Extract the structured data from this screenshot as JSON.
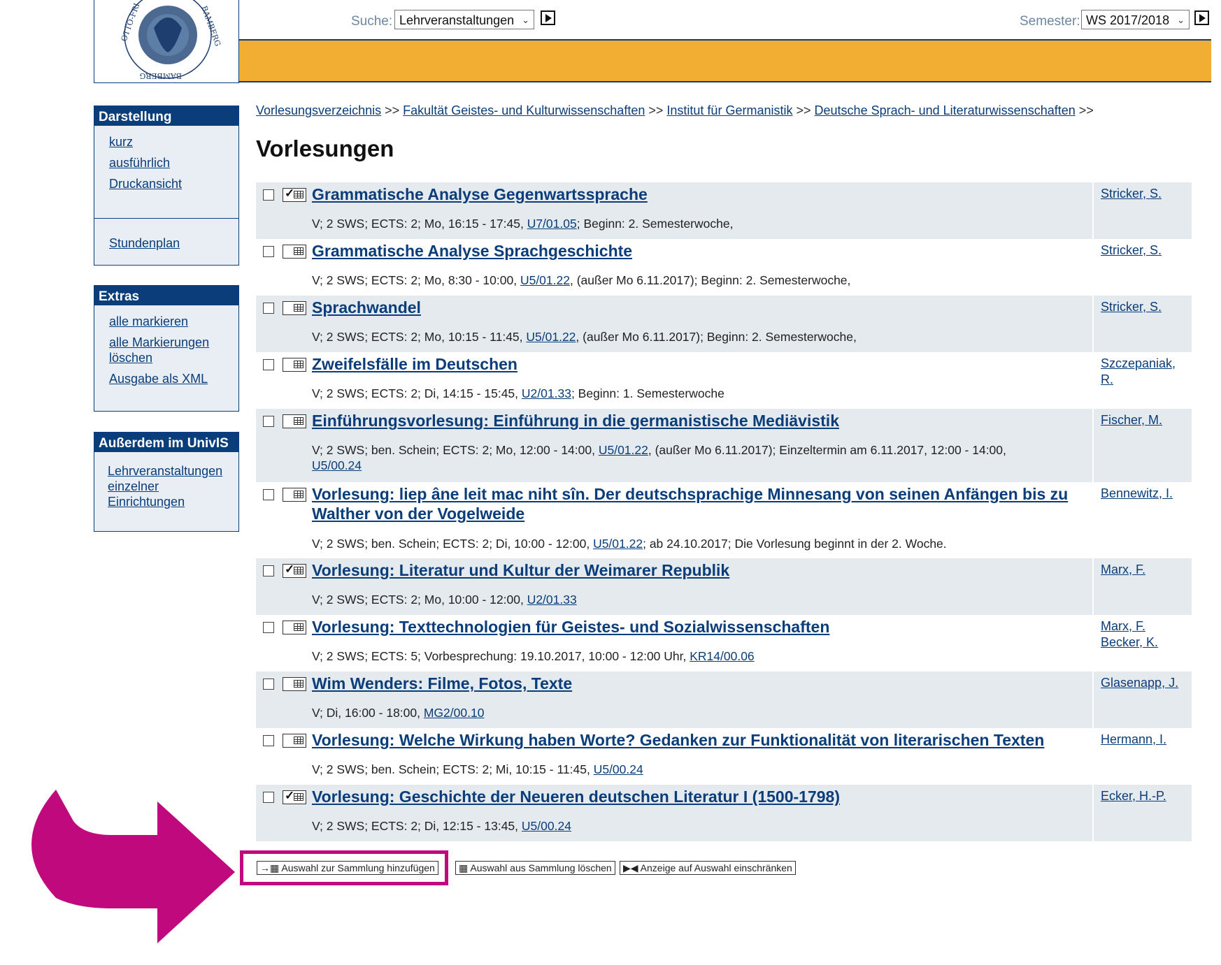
{
  "header": {
    "search_label": "Suche:",
    "search_value": "Lehrveranstaltungen",
    "semester_label": "Semester:",
    "semester_value": "WS 2017/2018",
    "accent_color": "#f2ae33",
    "brand_color": "#0a3d7a"
  },
  "sidebar": {
    "darstellung": {
      "title": "Darstellung",
      "links": [
        "kurz",
        "ausführlich",
        "Druckansicht"
      ],
      "stundenplan": "Stundenplan"
    },
    "extras": {
      "title": "Extras",
      "links": [
        "alle markieren",
        "alle Markierungen löschen",
        "Ausgabe als XML"
      ]
    },
    "ausserdem": {
      "title": "Außerdem im UnivIS",
      "link": "Lehrveranstaltungen einzelner Einrichtungen"
    }
  },
  "breadcrumb": {
    "items": [
      "Vorlesungsverzeichnis",
      "Fakultät Geistes- und Kulturwissenschaften",
      "Institut für Germanistik",
      "Deutsche Sprach- und Literaturwissenschaften"
    ],
    "separator": ">>"
  },
  "page_title": "Vorlesungen",
  "courses": [
    {
      "title": "Grammatische Analyse Gegenwartssprache",
      "checked_cal": true,
      "info_pre": "V; 2 SWS; ECTS: 2; Mo, 16:15 - 17:45, ",
      "room": "U7/01.05",
      "info_post": "; Beginn: 2. Semesterwoche,",
      "lecturers": [
        "Stricker, S."
      ]
    },
    {
      "title": "Grammatische Analyse Sprachgeschichte",
      "checked_cal": false,
      "info_pre": "V; 2 SWS; ECTS: 2; Mo, 8:30 - 10:00, ",
      "room": "U5/01.22",
      "info_post": ", (außer Mo 6.11.2017); Beginn: 2. Semesterwoche,",
      "lecturers": [
        "Stricker, S."
      ]
    },
    {
      "title": "Sprachwandel",
      "checked_cal": false,
      "info_pre": "V; 2 SWS; ECTS: 2; Mo, 10:15 - 11:45, ",
      "room": "U5/01.22",
      "info_post": ", (außer Mo 6.11.2017); Beginn: 2. Semesterwoche,",
      "lecturers": [
        "Stricker, S."
      ]
    },
    {
      "title": "Zweifelsfälle im Deutschen",
      "checked_cal": false,
      "info_pre": "V; 2 SWS; ECTS: 2; Di, 14:15 - 15:45, ",
      "room": "U2/01.33",
      "info_post": "; Beginn: 1. Semesterwoche",
      "lecturers": [
        "Szczepaniak, R."
      ]
    },
    {
      "title": "Einführungsvorlesung: Einführung in die germanistische Mediävistik",
      "checked_cal": false,
      "info_pre": "V; 2 SWS; ben. Schein; ECTS: 2; Mo, 12:00 - 14:00, ",
      "room": "U5/01.22",
      "info_post": ", (außer Mo 6.11.2017); Einzeltermin am 6.11.2017, 12:00 - 14:00,",
      "room2": "U5/00.24",
      "lecturers": [
        "Fischer, M."
      ]
    },
    {
      "title": "Vorlesung: liep âne leit mac niht sîn. Der deutschsprachige Minnesang von seinen Anfängen bis zu Walther von der Vogelweide",
      "checked_cal": false,
      "info_pre": "V; 2 SWS; ben. Schein; ECTS: 2; Di, 10:00 - 12:00, ",
      "room": "U5/01.22",
      "info_post": "; ab 24.10.2017; Die Vorlesung beginnt in der 2. Woche.",
      "lecturers": [
        "Bennewitz, I."
      ]
    },
    {
      "title": "Vorlesung: Literatur und Kultur der Weimarer Republik",
      "checked_cal": true,
      "info_pre": "V; 2 SWS; ECTS: 2; Mo, 10:00 - 12:00, ",
      "room": "U2/01.33",
      "info_post": "",
      "lecturers": [
        "Marx, F."
      ]
    },
    {
      "title": "Vorlesung: Texttechnologien für Geistes- und Sozialwissenschaften",
      "checked_cal": false,
      "info_pre": "V; 2 SWS; ECTS: 5; Vorbesprechung: 19.10.2017, 10:00 - 12:00 Uhr, ",
      "room": "KR14/00.06",
      "info_post": "",
      "lecturers": [
        "Marx, F.",
        "Becker, K."
      ]
    },
    {
      "title": "Wim Wenders: Filme, Fotos, Texte",
      "checked_cal": false,
      "info_pre": "V; Di, 16:00 - 18:00, ",
      "room": "MG2/00.10",
      "info_post": "",
      "lecturers": [
        "Glasenapp, J."
      ]
    },
    {
      "title": "Vorlesung: Welche Wirkung haben Worte? Gedanken zur Funktionalität von literarischen Texten",
      "checked_cal": false,
      "info_pre": "V; 2 SWS; ben. Schein; ECTS: 2; Mi, 10:15 - 11:45, ",
      "room": "U5/00.24",
      "info_post": "",
      "lecturers": [
        "Hermann, I."
      ]
    },
    {
      "title": "Vorlesung: Geschichte der Neueren deutschen Literatur I (1500-1798)",
      "checked_cal": true,
      "info_pre": "V; 2 SWS; ECTS: 2; Di, 12:15 - 13:45, ",
      "room": "U5/00.24",
      "info_post": "",
      "lecturers": [
        "Ecker, H.-P."
      ]
    }
  ],
  "actions": {
    "add": "Auswahl zur Sammlung hinzufügen",
    "remove": "Auswahl aus Sammlung löschen",
    "restrict": "Anzeige auf Auswahl einschränken"
  },
  "annotation": {
    "arrow_color": "#c0097c"
  }
}
